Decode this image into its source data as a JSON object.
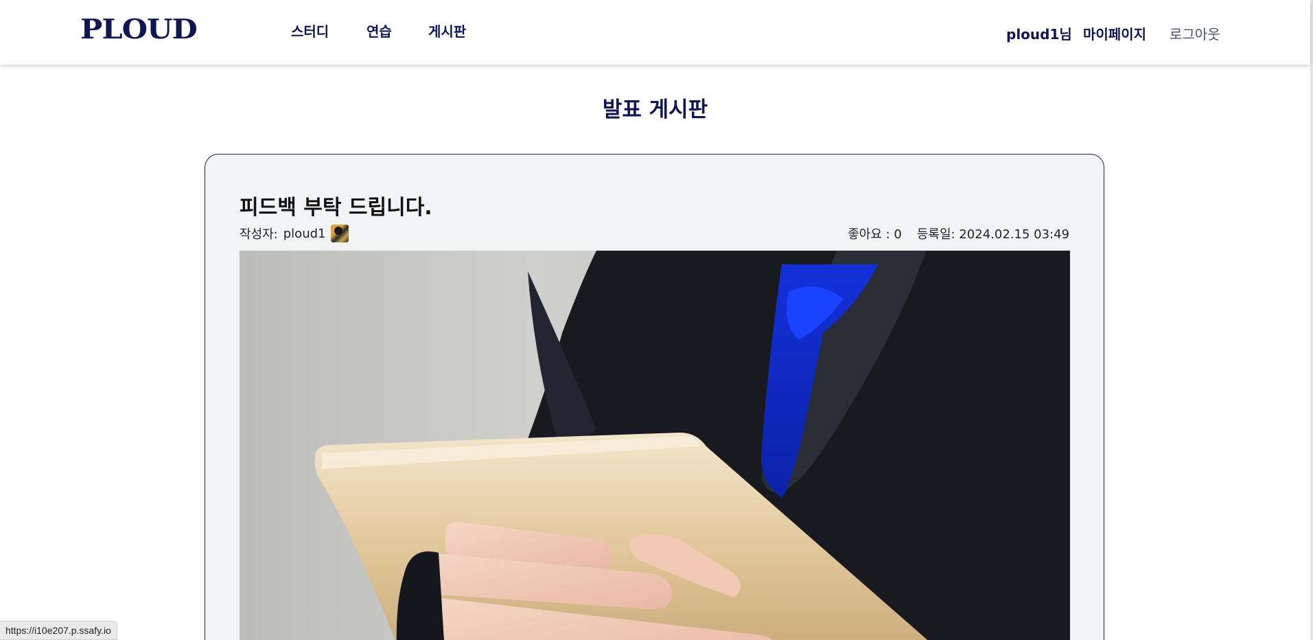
{
  "header": {
    "logo": "PLOUD",
    "nav": [
      {
        "label": "스터디"
      },
      {
        "label": "연습"
      },
      {
        "label": "게시판"
      }
    ],
    "user": {
      "name": "ploud1님",
      "mypage": "마이페이지",
      "logout": "로그아웃"
    }
  },
  "page": {
    "title": "발표 게시판"
  },
  "post": {
    "title": "피드백 부탁 드립니다.",
    "author_label": "작성자:",
    "author_name": "ploud1",
    "likes": "좋아요 : 0",
    "date": "등록일: 2024.02.15 03:49"
  },
  "status_bar": {
    "url": "https://i10e207.p.ssafy.io"
  },
  "colors": {
    "brand_navy": "#0f1653",
    "card_bg": "#f2f3f5",
    "blouse_blue": "#1238d6"
  }
}
